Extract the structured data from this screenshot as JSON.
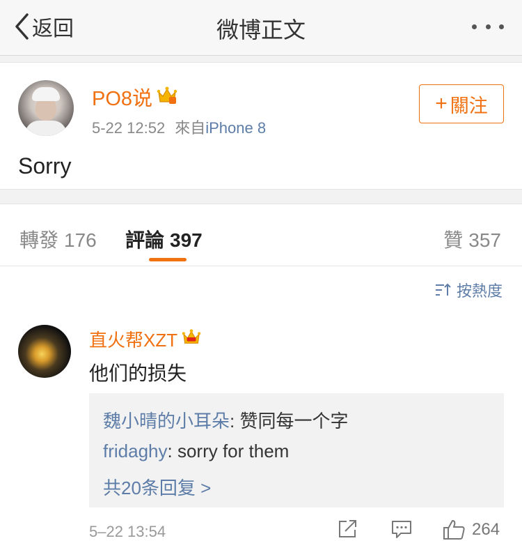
{
  "nav": {
    "back_label": "返回",
    "title": "微博正文"
  },
  "post": {
    "author": "PO8说",
    "time": "5-22 12:52",
    "source_prefix": "來自",
    "source": "iPhone 8",
    "follow_label": "關注",
    "text": "Sorry"
  },
  "tabs": {
    "repost_label": "轉發",
    "repost_count": "176",
    "comment_label": "評論",
    "comment_count": "397",
    "like_label": "贊",
    "like_count": "357"
  },
  "comments": {
    "sort_label": "按熱度",
    "items": [
      {
        "author": "直火帮XZT",
        "text": "他们的损失",
        "replies": [
          {
            "who": "魏小晴的小耳朵",
            "text": ": 赞同每一个字"
          },
          {
            "who": "fridaghy",
            "text": ": sorry for them"
          }
        ],
        "more_label": "共20条回复 >",
        "time": "5–22 13:54",
        "like_count": "264"
      }
    ]
  },
  "colors": {
    "accent": "#f1700f",
    "link": "#5d7da8",
    "crown": "#f5b400"
  },
  "icons": [
    "chevron-left-icon",
    "more-icon",
    "crown-icon",
    "plus-icon",
    "sort-icon",
    "share-icon",
    "comment-icon",
    "thumbs-up-icon"
  ]
}
